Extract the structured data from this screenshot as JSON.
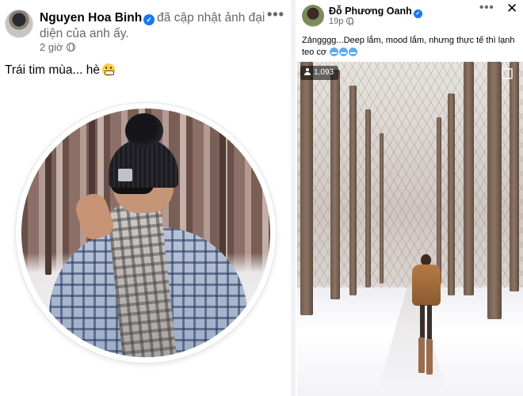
{
  "left_post": {
    "author_name": "Nguyen Hoa Binh",
    "verified_mark": "✓",
    "action_text": "đã cập nhật ảnh đại diện của anh ấy.",
    "time": "2 giờ",
    "more_label": "•••",
    "caption": "Trái tim mùa... hè",
    "caption_emoji": "grimacing-face-icon",
    "photo_type": "profile-picture"
  },
  "right_post": {
    "author_name": "Đỗ Phương Oanh",
    "verified_mark": "✓",
    "time": "19p",
    "more_label": "•••",
    "close_label": "✕",
    "caption": "Zảngggg...Deep lắm, mood lắm, nhưng thực tế thì lạnh teo cơ",
    "caption_emoji": "cold-face-icon",
    "caption_emoji_count": 3,
    "view_count": "1.093"
  },
  "colors": {
    "verified_blue": "#1877f2",
    "secondary_text": "#65676b",
    "feed_background": "#f0f2f5"
  }
}
